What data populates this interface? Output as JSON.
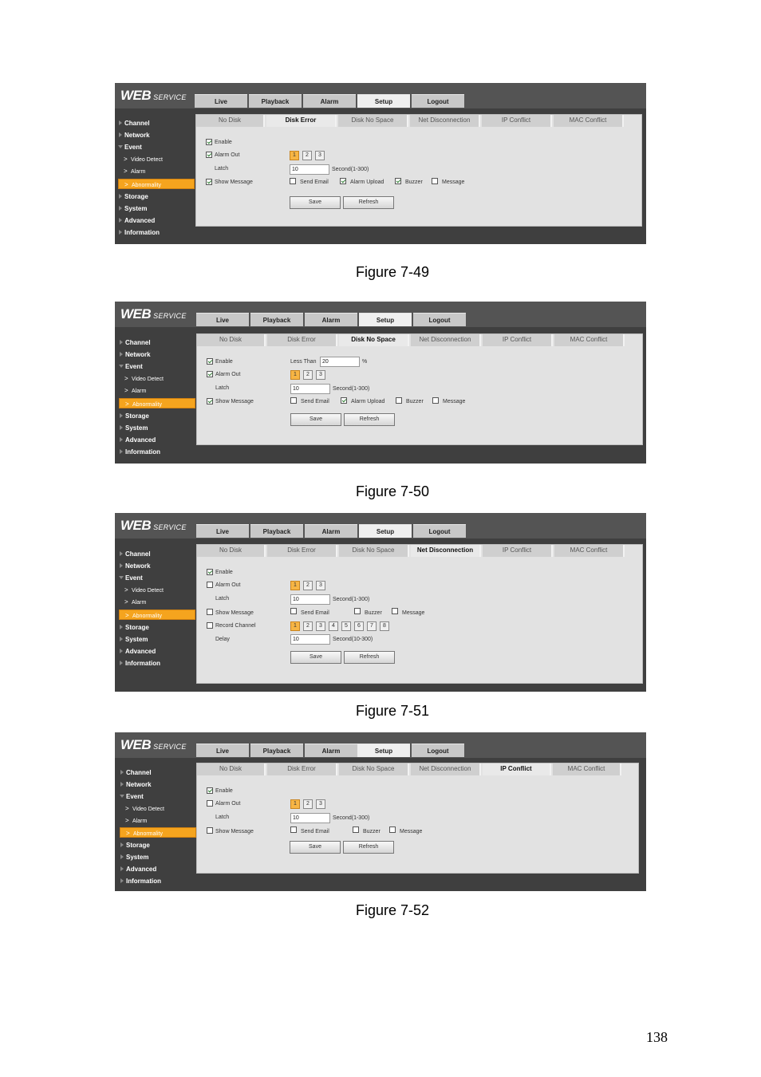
{
  "logo": {
    "web": "WEB",
    "service": "SERVICE"
  },
  "main_tabs": [
    "Live",
    "Playback",
    "Alarm",
    "Setup",
    "Logout"
  ],
  "sidebar": {
    "channel": "Channel",
    "network": "Network",
    "event": "Event",
    "video_detect": "Video Detect",
    "alarm": "Alarm",
    "abnormality": "Abnormality",
    "storage": "Storage",
    "system": "System",
    "advanced": "Advanced",
    "information": "Information"
  },
  "sub_tabs": [
    "No Disk",
    "Disk Error",
    "Disk No Space",
    "Net Disconnection",
    "IP Conflict",
    "MAC Conflict"
  ],
  "labels": {
    "enable": "Enable",
    "alarm_out": "Alarm Out",
    "latch": "Latch",
    "show_message": "Show Message",
    "send_email": "Send Email",
    "alarm_upload": "Alarm Upload",
    "buzzer": "Buzzer",
    "message": "Message",
    "less_than": "Less Than",
    "percent": "%",
    "second_1_300": "Second(1-300)",
    "second_10_300": "Second(10-300)",
    "record_channel": "Record Channel",
    "delay": "Delay",
    "save": "Save",
    "refresh": "Refresh"
  },
  "fig49": {
    "caption": "Figure 7-49",
    "latch": "10"
  },
  "fig50": {
    "caption": "Figure 7-50",
    "less_than": "20",
    "latch": "10"
  },
  "fig51": {
    "caption": "Figure 7-51",
    "latch": "10",
    "delay": "10",
    "record_channels": [
      "1",
      "2",
      "3",
      "4",
      "5",
      "6",
      "7",
      "8"
    ]
  },
  "fig52": {
    "caption": "Figure 7-52",
    "latch": "10"
  },
  "alarm_out_channels": [
    "1",
    "2",
    "3"
  ],
  "page_number": "138"
}
